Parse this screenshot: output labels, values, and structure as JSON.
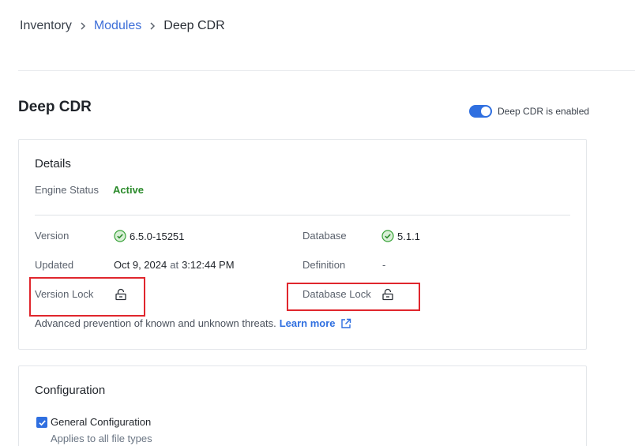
{
  "breadcrumb": {
    "items": [
      "Inventory",
      "Modules",
      "Deep CDR"
    ]
  },
  "page": {
    "title": "Deep CDR",
    "toggle_label": "Deep CDR is enabled",
    "toggle_on": true
  },
  "details": {
    "title": "Details",
    "engine_status_label": "Engine Status",
    "engine_status_value": "Active",
    "version_label": "Version",
    "version_value": "6.5.0-15251",
    "updated_label": "Updated",
    "updated_date": "Oct 9, 2024",
    "updated_at": "at",
    "updated_time": "3:12:44 PM",
    "version_lock_label": "Version Lock",
    "database_label": "Database",
    "database_value": "5.1.1",
    "definition_label": "Definition",
    "definition_value": "-",
    "database_lock_label": "Database Lock",
    "description": "Advanced prevention of known and unknown threats.",
    "learn_more": "Learn more"
  },
  "configuration": {
    "title": "Configuration",
    "general_label": "General Configuration",
    "general_checked": true,
    "general_sub": "Applies to all file types"
  },
  "colors": {
    "accent": "#2f6fe0",
    "status_active": "#2a8a2a",
    "highlight": "#e0262d"
  },
  "icons": [
    "chevron-right-icon",
    "check-circle-icon",
    "unlock-icon",
    "external-link-icon",
    "checkbox-icon"
  ]
}
